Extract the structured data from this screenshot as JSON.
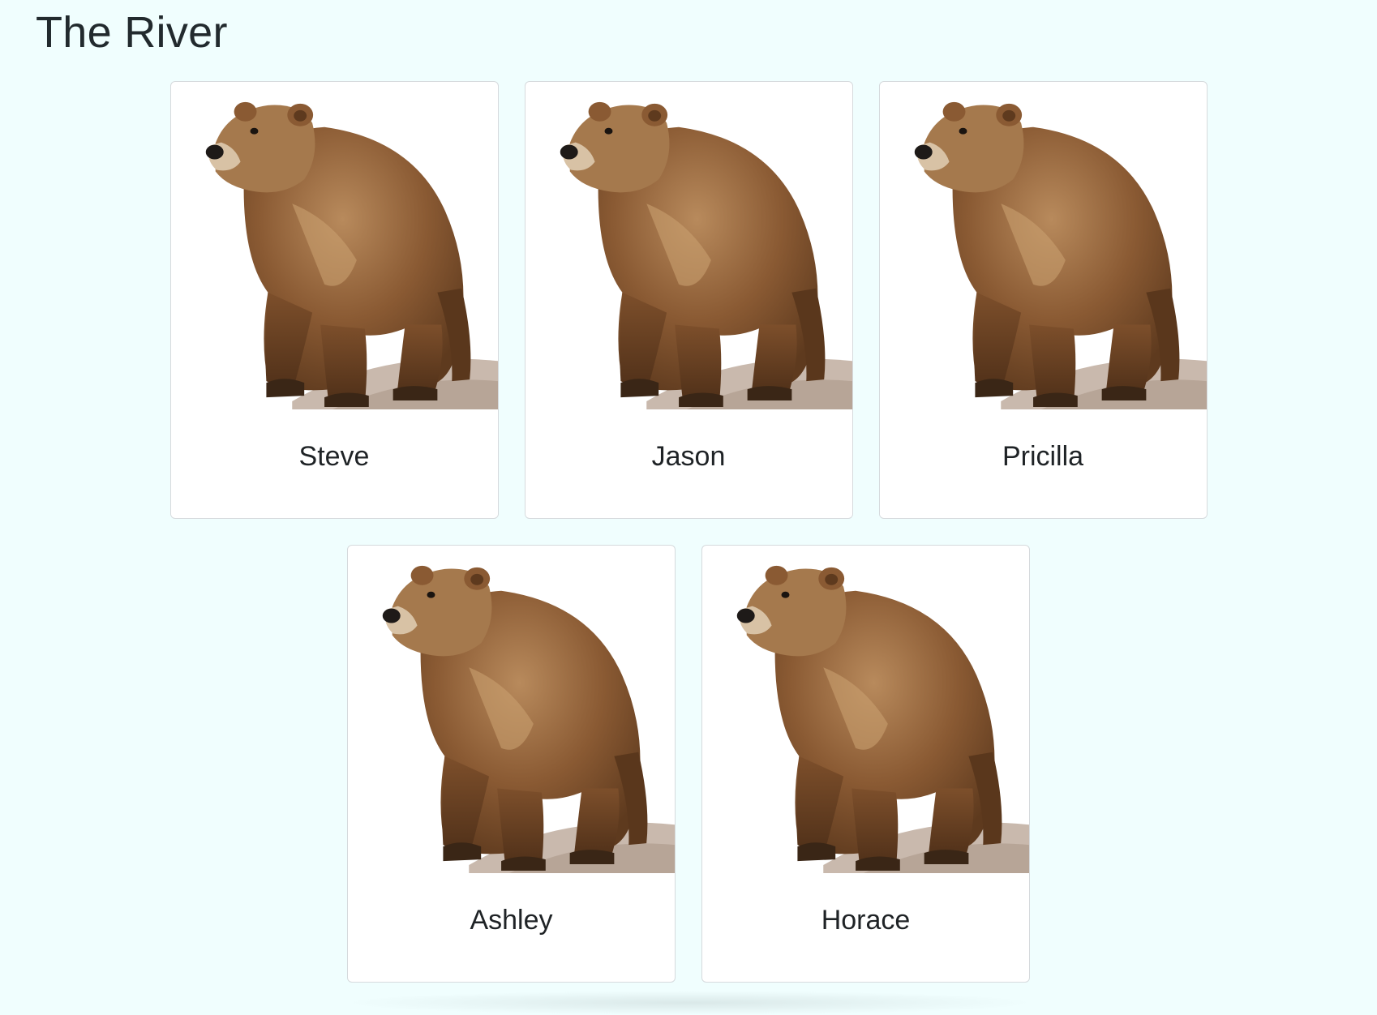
{
  "page": {
    "title": "The River",
    "background": "#f0fefe"
  },
  "cards": [
    {
      "name": "Steve",
      "image_icon": "brown-bear-image"
    },
    {
      "name": "Jason",
      "image_icon": "brown-bear-image"
    },
    {
      "name": "Pricilla",
      "image_icon": "brown-bear-image"
    },
    {
      "name": "Ashley",
      "image_icon": "brown-bear-image"
    },
    {
      "name": "Horace",
      "image_icon": "brown-bear-image"
    }
  ],
  "colors": {
    "bear_fur": "#8a5a33",
    "bear_fur_dark": "#5e3a1e",
    "bear_fur_light": "#b88a5c",
    "rock": "#c9b9ad",
    "card_border": "#d6dadd"
  }
}
